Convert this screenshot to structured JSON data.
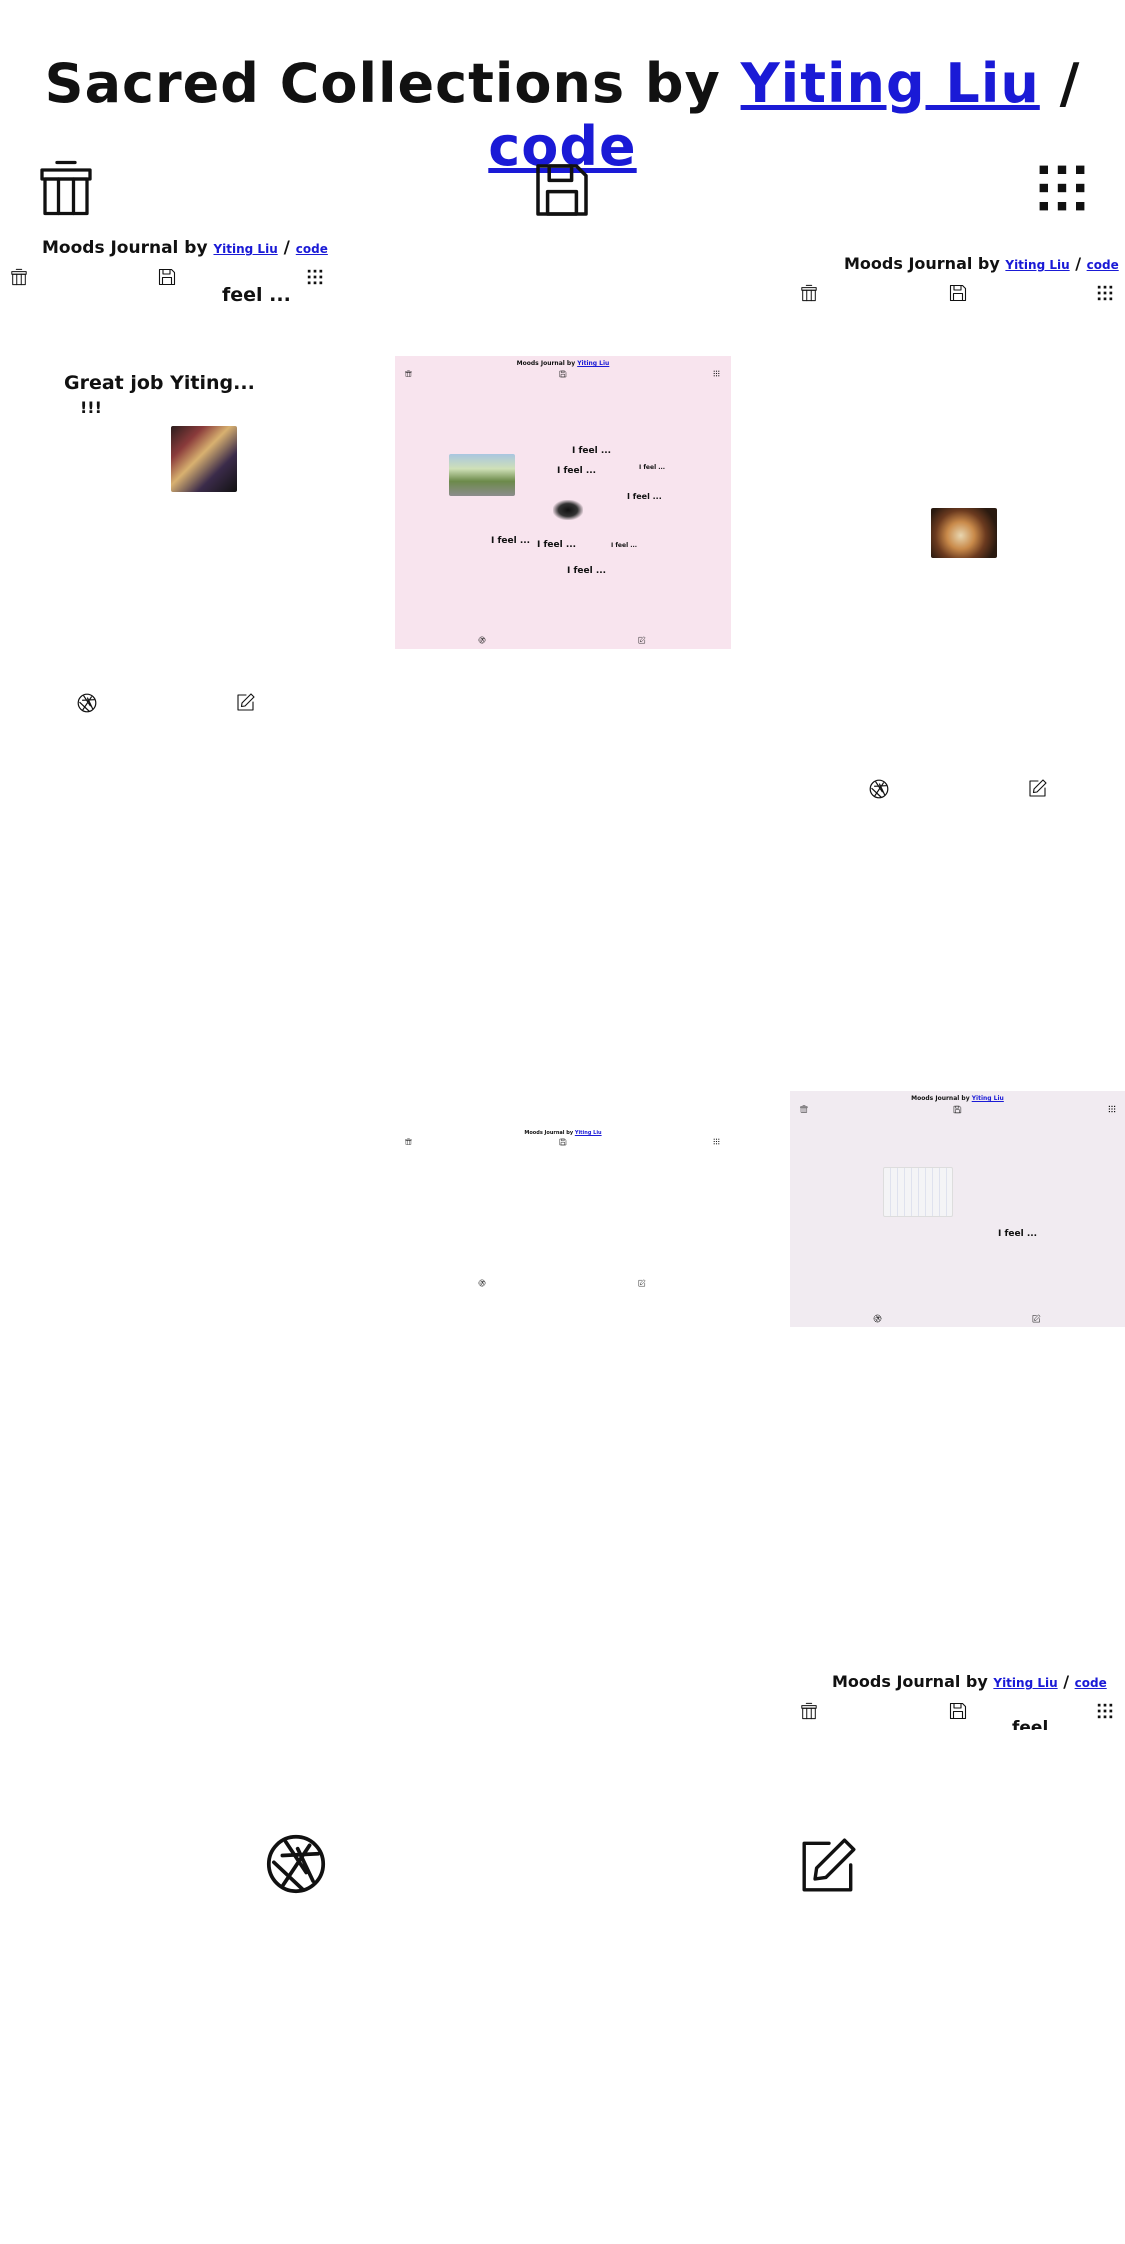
{
  "page": {
    "title_prefix": "Sacred Collections by ",
    "author": "Yiting Liu",
    "separator": " / ",
    "code": "code"
  },
  "journal": {
    "title_prefix": "Moods Journal by ",
    "author": "Yiting Liu",
    "separator": " / ",
    "code": "code"
  },
  "panel_a": {
    "feel": "feel ...",
    "message_line1": "Great job Yiting...",
    "message_line2": "!!!"
  },
  "panel_b": {
    "feels": [
      "I feel ...",
      "I feel ...",
      "I feel ...",
      "I feel ...",
      "I feel ...",
      "I feel ...",
      "I feel ...",
      "I feel ..."
    ]
  },
  "panel_d": {
    "feel": "I feel ..."
  },
  "panel_f": {
    "feel": "feel"
  },
  "icons": {
    "archive": "archive-box-icon",
    "save": "floppy-disk-icon",
    "grid": "grid-dots-icon",
    "camera": "camera-aperture-icon",
    "edit": "pencil-square-icon"
  },
  "colors": {
    "link": "#1a1ad6",
    "panel_b_bg": "#f8e4ee",
    "panel_d_bg": "#f1ebf1"
  }
}
